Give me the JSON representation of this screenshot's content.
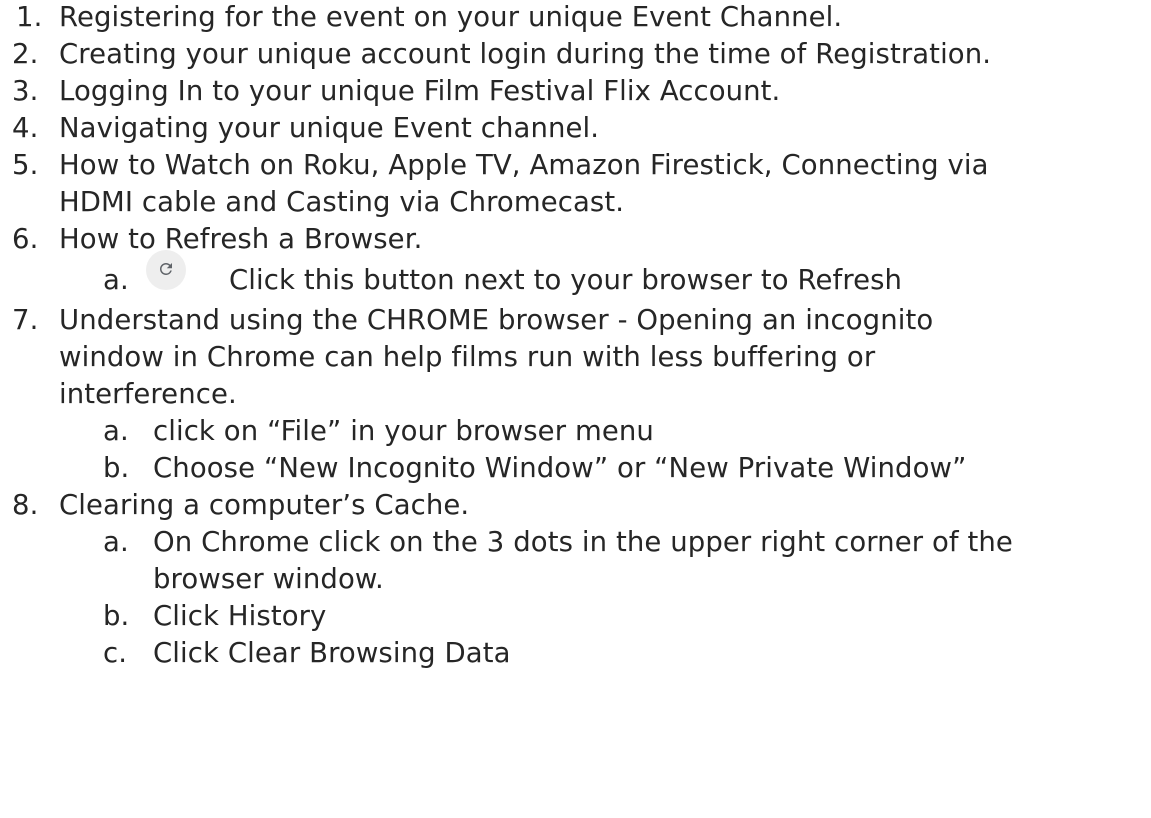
{
  "items": [
    {
      "marker": "1.",
      "text": "Registering for the event on your unique Event Channel."
    },
    {
      "marker": "2.",
      "text": "Creating your unique account login during the time of Registration."
    },
    {
      "marker": "3.",
      "text": "Logging In to your unique Film Festival Flix Account."
    },
    {
      "marker": "4.",
      "text": "Navigating your unique Event channel."
    },
    {
      "marker": "5.",
      "text_lines": [
        "How to Watch on Roku, Apple TV, Amazon Firestick, Connecting via",
        "HDMI cable and Casting via Chromecast."
      ]
    },
    {
      "marker": "6.",
      "text": "How to Refresh a Browser.",
      "subitems": [
        {
          "marker": "a.",
          "icon": "refresh-icon",
          "text": "Click this button next to your browser to Refresh"
        }
      ]
    },
    {
      "marker": "7.",
      "text_lines": [
        "Understand using the CHROME browser - Opening an incognito",
        "window in Chrome can help films run with less buffering or",
        "interference."
      ],
      "subitems": [
        {
          "marker": "a.",
          "text": "click on “File” in your browser menu"
        },
        {
          "marker": "b.",
          "text": "Choose “New Incognito Window” or “New Private Window”"
        }
      ]
    },
    {
      "marker": "8.",
      "text": "Clearing a computer’s Cache.",
      "subitems": [
        {
          "marker": "a.",
          "text_lines": [
            "On Chrome click on the 3 dots in the upper right corner of the",
            "browser window."
          ]
        },
        {
          "marker": "b.",
          "text": "Click History"
        },
        {
          "marker": "c.",
          "text": "Click Clear Browsing Data"
        }
      ]
    }
  ]
}
